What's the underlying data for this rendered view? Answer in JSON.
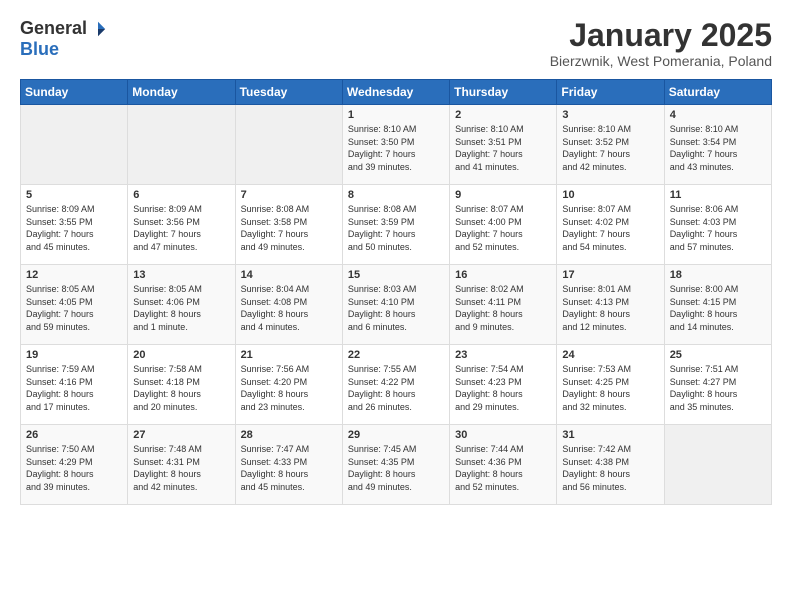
{
  "header": {
    "logo_general": "General",
    "logo_blue": "Blue",
    "month_title": "January 2025",
    "location": "Bierzwnik, West Pomerania, Poland"
  },
  "weekdays": [
    "Sunday",
    "Monday",
    "Tuesday",
    "Wednesday",
    "Thursday",
    "Friday",
    "Saturday"
  ],
  "weeks": [
    [
      {
        "day": "",
        "info": ""
      },
      {
        "day": "",
        "info": ""
      },
      {
        "day": "",
        "info": ""
      },
      {
        "day": "1",
        "info": "Sunrise: 8:10 AM\nSunset: 3:50 PM\nDaylight: 7 hours\nand 39 minutes."
      },
      {
        "day": "2",
        "info": "Sunrise: 8:10 AM\nSunset: 3:51 PM\nDaylight: 7 hours\nand 41 minutes."
      },
      {
        "day": "3",
        "info": "Sunrise: 8:10 AM\nSunset: 3:52 PM\nDaylight: 7 hours\nand 42 minutes."
      },
      {
        "day": "4",
        "info": "Sunrise: 8:10 AM\nSunset: 3:54 PM\nDaylight: 7 hours\nand 43 minutes."
      }
    ],
    [
      {
        "day": "5",
        "info": "Sunrise: 8:09 AM\nSunset: 3:55 PM\nDaylight: 7 hours\nand 45 minutes."
      },
      {
        "day": "6",
        "info": "Sunrise: 8:09 AM\nSunset: 3:56 PM\nDaylight: 7 hours\nand 47 minutes."
      },
      {
        "day": "7",
        "info": "Sunrise: 8:08 AM\nSunset: 3:58 PM\nDaylight: 7 hours\nand 49 minutes."
      },
      {
        "day": "8",
        "info": "Sunrise: 8:08 AM\nSunset: 3:59 PM\nDaylight: 7 hours\nand 50 minutes."
      },
      {
        "day": "9",
        "info": "Sunrise: 8:07 AM\nSunset: 4:00 PM\nDaylight: 7 hours\nand 52 minutes."
      },
      {
        "day": "10",
        "info": "Sunrise: 8:07 AM\nSunset: 4:02 PM\nDaylight: 7 hours\nand 54 minutes."
      },
      {
        "day": "11",
        "info": "Sunrise: 8:06 AM\nSunset: 4:03 PM\nDaylight: 7 hours\nand 57 minutes."
      }
    ],
    [
      {
        "day": "12",
        "info": "Sunrise: 8:05 AM\nSunset: 4:05 PM\nDaylight: 7 hours\nand 59 minutes."
      },
      {
        "day": "13",
        "info": "Sunrise: 8:05 AM\nSunset: 4:06 PM\nDaylight: 8 hours\nand 1 minute."
      },
      {
        "day": "14",
        "info": "Sunrise: 8:04 AM\nSunset: 4:08 PM\nDaylight: 8 hours\nand 4 minutes."
      },
      {
        "day": "15",
        "info": "Sunrise: 8:03 AM\nSunset: 4:10 PM\nDaylight: 8 hours\nand 6 minutes."
      },
      {
        "day": "16",
        "info": "Sunrise: 8:02 AM\nSunset: 4:11 PM\nDaylight: 8 hours\nand 9 minutes."
      },
      {
        "day": "17",
        "info": "Sunrise: 8:01 AM\nSunset: 4:13 PM\nDaylight: 8 hours\nand 12 minutes."
      },
      {
        "day": "18",
        "info": "Sunrise: 8:00 AM\nSunset: 4:15 PM\nDaylight: 8 hours\nand 14 minutes."
      }
    ],
    [
      {
        "day": "19",
        "info": "Sunrise: 7:59 AM\nSunset: 4:16 PM\nDaylight: 8 hours\nand 17 minutes."
      },
      {
        "day": "20",
        "info": "Sunrise: 7:58 AM\nSunset: 4:18 PM\nDaylight: 8 hours\nand 20 minutes."
      },
      {
        "day": "21",
        "info": "Sunrise: 7:56 AM\nSunset: 4:20 PM\nDaylight: 8 hours\nand 23 minutes."
      },
      {
        "day": "22",
        "info": "Sunrise: 7:55 AM\nSunset: 4:22 PM\nDaylight: 8 hours\nand 26 minutes."
      },
      {
        "day": "23",
        "info": "Sunrise: 7:54 AM\nSunset: 4:23 PM\nDaylight: 8 hours\nand 29 minutes."
      },
      {
        "day": "24",
        "info": "Sunrise: 7:53 AM\nSunset: 4:25 PM\nDaylight: 8 hours\nand 32 minutes."
      },
      {
        "day": "25",
        "info": "Sunrise: 7:51 AM\nSunset: 4:27 PM\nDaylight: 8 hours\nand 35 minutes."
      }
    ],
    [
      {
        "day": "26",
        "info": "Sunrise: 7:50 AM\nSunset: 4:29 PM\nDaylight: 8 hours\nand 39 minutes."
      },
      {
        "day": "27",
        "info": "Sunrise: 7:48 AM\nSunset: 4:31 PM\nDaylight: 8 hours\nand 42 minutes."
      },
      {
        "day": "28",
        "info": "Sunrise: 7:47 AM\nSunset: 4:33 PM\nDaylight: 8 hours\nand 45 minutes."
      },
      {
        "day": "29",
        "info": "Sunrise: 7:45 AM\nSunset: 4:35 PM\nDaylight: 8 hours\nand 49 minutes."
      },
      {
        "day": "30",
        "info": "Sunrise: 7:44 AM\nSunset: 4:36 PM\nDaylight: 8 hours\nand 52 minutes."
      },
      {
        "day": "31",
        "info": "Sunrise: 7:42 AM\nSunset: 4:38 PM\nDaylight: 8 hours\nand 56 minutes."
      },
      {
        "day": "",
        "info": ""
      }
    ]
  ]
}
